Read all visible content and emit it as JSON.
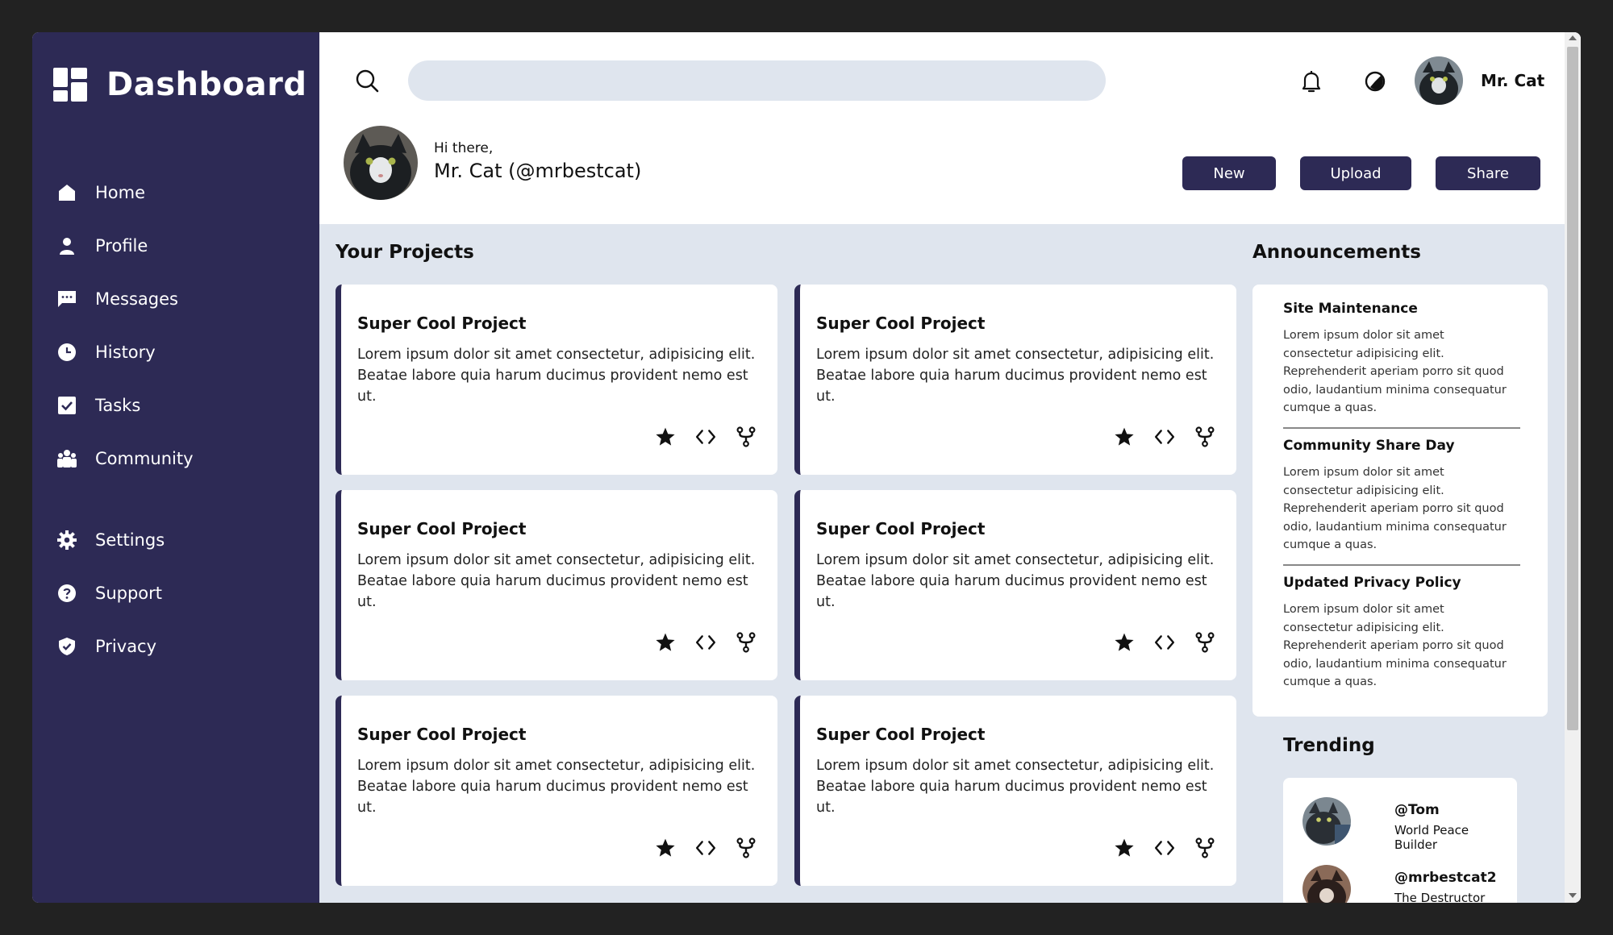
{
  "brand": {
    "title": "Dashboard"
  },
  "sidebar": {
    "items": [
      {
        "label": "Home",
        "icon": "home-icon"
      },
      {
        "label": "Profile",
        "icon": "user-icon"
      },
      {
        "label": "Messages",
        "icon": "message-icon"
      },
      {
        "label": "History",
        "icon": "clock-icon"
      },
      {
        "label": "Tasks",
        "icon": "check-square-icon"
      },
      {
        "label": "Community",
        "icon": "people-icon"
      },
      {
        "label": "Settings",
        "icon": "gear-icon"
      },
      {
        "label": "Support",
        "icon": "question-icon"
      },
      {
        "label": "Privacy",
        "icon": "shield-icon"
      }
    ]
  },
  "topbar": {
    "search_placeholder": "",
    "username": "Mr. Cat"
  },
  "greeting": {
    "hi": "Hi there,",
    "name": "Mr. Cat (@mrbestcat)"
  },
  "actions": {
    "new": "New",
    "upload": "Upload",
    "share": "Share"
  },
  "projects": {
    "title": "Your Projects",
    "items": [
      {
        "title": "Super Cool Project",
        "desc": "Lorem ipsum dolor sit amet consectetur, adipisicing elit. Beatae labore quia harum ducimus provident nemo est ut."
      },
      {
        "title": "Super Cool Project",
        "desc": "Lorem ipsum dolor sit amet consectetur, adipisicing elit. Beatae labore quia harum ducimus provident nemo est ut."
      },
      {
        "title": "Super Cool Project",
        "desc": "Lorem ipsum dolor sit amet consectetur, adipisicing elit. Beatae labore quia harum ducimus provident nemo est ut."
      },
      {
        "title": "Super Cool Project",
        "desc": "Lorem ipsum dolor sit amet consectetur, adipisicing elit. Beatae labore quia harum ducimus provident nemo est ut."
      },
      {
        "title": "Super Cool Project",
        "desc": "Lorem ipsum dolor sit amet consectetur, adipisicing elit. Beatae labore quia harum ducimus provident nemo est ut."
      },
      {
        "title": "Super Cool Project",
        "desc": "Lorem ipsum dolor sit amet consectetur, adipisicing elit. Beatae labore quia harum ducimus provident nemo est ut."
      }
    ]
  },
  "announcements": {
    "title": "Announcements",
    "items": [
      {
        "title": "Site Maintenance",
        "body": "Lorem ipsum dolor sit amet consectetur adipisicing elit. Reprehenderit aperiam porro sit quod odio, laudantium minima consequatur cumque a quas."
      },
      {
        "title": "Community Share Day",
        "body": "Lorem ipsum dolor sit amet consectetur adipisicing elit. Reprehenderit aperiam porro sit quod odio, laudantium minima consequatur cumque a quas."
      },
      {
        "title": "Updated Privacy Policy",
        "body": "Lorem ipsum dolor sit amet consectetur adipisicing elit. Reprehenderit aperiam porro sit quod odio, laudantium minima consequatur cumque a quas."
      }
    ]
  },
  "trending": {
    "title": "Trending",
    "items": [
      {
        "handle": "@Tom",
        "role": "World Peace Builder"
      },
      {
        "handle": "@mrbestcat2",
        "role": "The Destructor"
      }
    ]
  },
  "colors": {
    "sidebar": "#2d2a55",
    "accent": "#2d2a55",
    "background": "#dfe5ee"
  }
}
